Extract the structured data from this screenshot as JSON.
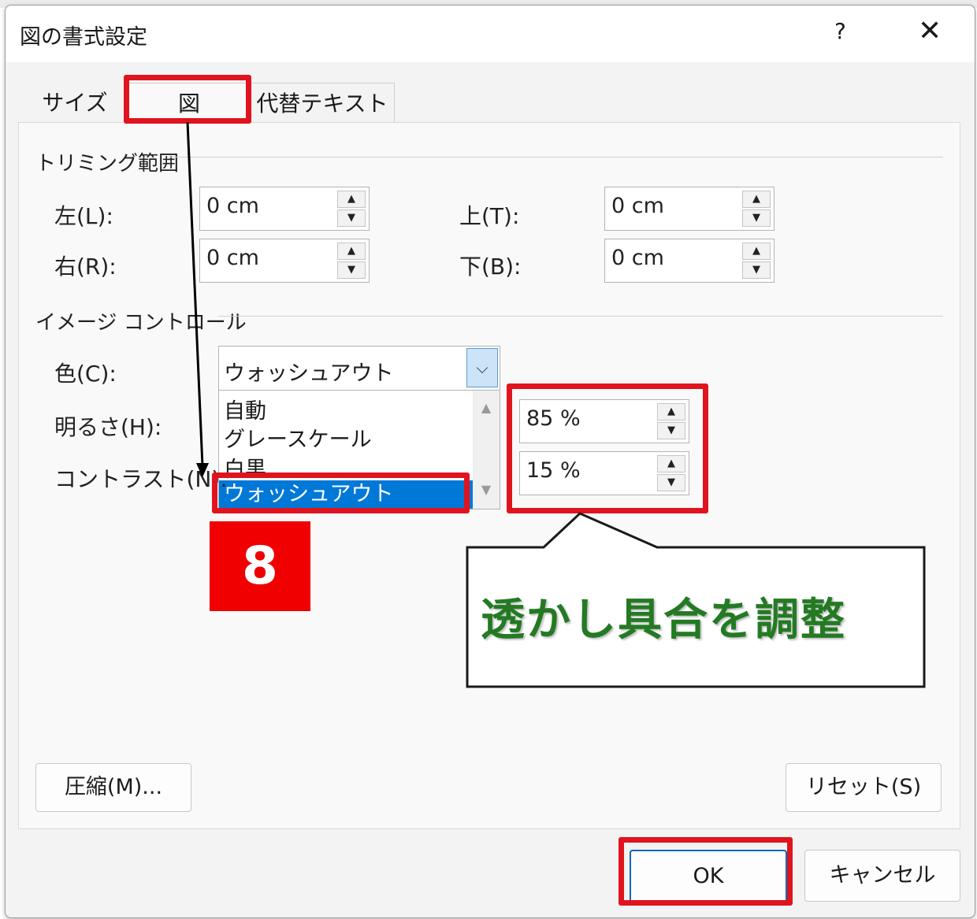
{
  "dialog": {
    "title": "図の書式設定",
    "help": "?",
    "close": "✕"
  },
  "tabs": [
    {
      "label": "サイズ"
    },
    {
      "label": "図"
    },
    {
      "label": "代替テキスト"
    }
  ],
  "cropping": {
    "section": "トリミング範囲",
    "left_label": "左(L):",
    "left_value": "0 cm",
    "top_label": "上(T):",
    "top_value": "0 cm",
    "right_label": "右(R):",
    "right_value": "0 cm",
    "bottom_label": "下(B):",
    "bottom_value": "0 cm"
  },
  "image_control": {
    "section": "イメージ コントロール",
    "color_label": "色(C):",
    "color_value": "ウォッシュアウト",
    "color_options": [
      "自動",
      "グレースケール",
      "白黒",
      "ウォッシュアウト"
    ],
    "brightness_label": "明るさ(H):",
    "brightness_value": "85 %",
    "contrast_label": "コントラスト(N):",
    "contrast_value": "15 %"
  },
  "buttons": {
    "compress": "圧縮(M)...",
    "reset": "リセット(S)",
    "ok": "OK",
    "cancel": "キャンセル"
  },
  "annotation": {
    "step_number": "8",
    "callout": "透かし具合を調整",
    "color": "#e0141e",
    "callout_color": "#237a23"
  }
}
